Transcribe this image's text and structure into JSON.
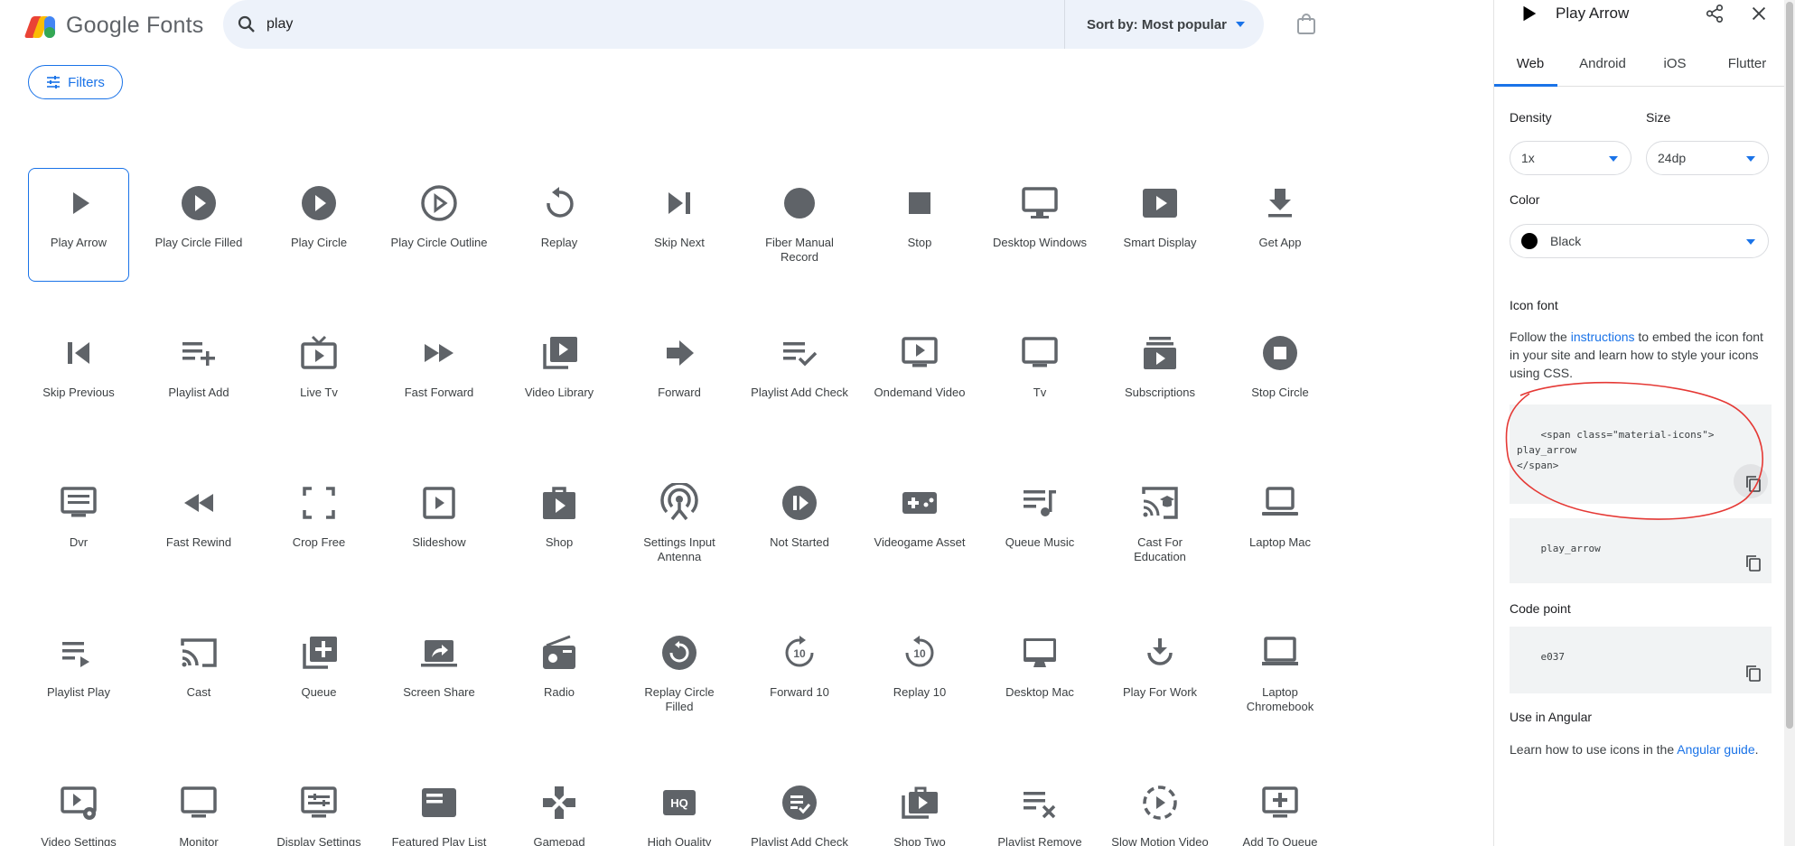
{
  "header": {
    "logo_text": "Google Fonts",
    "search_value": "play",
    "sort_label": "Sort by: Most popular",
    "filters_label": "Filters"
  },
  "colors": {
    "accent": "#1a73e8",
    "icon_gray": "#5f6368",
    "annotation": "#e53935"
  },
  "icons": [
    {
      "label": "Play Arrow",
      "icon": "play-arrow"
    },
    {
      "label": "Play Circle Filled",
      "icon": "play-circle-filled"
    },
    {
      "label": "Play Circle",
      "icon": "play-circle"
    },
    {
      "label": "Play Circle Outline",
      "icon": "play-circle-outline"
    },
    {
      "label": "Replay",
      "icon": "replay"
    },
    {
      "label": "Skip Next",
      "icon": "skip-next"
    },
    {
      "label": "Fiber Manual Record",
      "icon": "fiber-manual-record"
    },
    {
      "label": "Stop",
      "icon": "stop"
    },
    {
      "label": "Desktop Windows",
      "icon": "desktop-windows"
    },
    {
      "label": "Smart Display",
      "icon": "smart-display"
    },
    {
      "label": "Get App",
      "icon": "get-app"
    },
    {
      "label": "Skip Previous",
      "icon": "skip-previous"
    },
    {
      "label": "Playlist Add",
      "icon": "playlist-add"
    },
    {
      "label": "Live Tv",
      "icon": "live-tv"
    },
    {
      "label": "Fast Forward",
      "icon": "fast-forward"
    },
    {
      "label": "Video Library",
      "icon": "video-library"
    },
    {
      "label": "Forward",
      "icon": "forward"
    },
    {
      "label": "Playlist Add Check",
      "icon": "playlist-add-check"
    },
    {
      "label": "Ondemand Video",
      "icon": "ondemand-video"
    },
    {
      "label": "Tv",
      "icon": "tv"
    },
    {
      "label": "Subscriptions",
      "icon": "subscriptions"
    },
    {
      "label": "Stop Circle",
      "icon": "stop-circle"
    },
    {
      "label": "Dvr",
      "icon": "dvr"
    },
    {
      "label": "Fast Rewind",
      "icon": "fast-rewind"
    },
    {
      "label": "Crop Free",
      "icon": "crop-free"
    },
    {
      "label": "Slideshow",
      "icon": "slideshow"
    },
    {
      "label": "Shop",
      "icon": "shop"
    },
    {
      "label": "Settings Input Antenna",
      "icon": "settings-input-antenna"
    },
    {
      "label": "Not Started",
      "icon": "not-started"
    },
    {
      "label": "Videogame Asset",
      "icon": "videogame-asset"
    },
    {
      "label": "Queue Music",
      "icon": "queue-music"
    },
    {
      "label": "Cast For Education",
      "icon": "cast-for-education"
    },
    {
      "label": "Laptop Mac",
      "icon": "laptop-mac"
    },
    {
      "label": "Playlist Play",
      "icon": "playlist-play"
    },
    {
      "label": "Cast",
      "icon": "cast"
    },
    {
      "label": "Queue",
      "icon": "queue"
    },
    {
      "label": "Screen Share",
      "icon": "screen-share"
    },
    {
      "label": "Radio",
      "icon": "radio"
    },
    {
      "label": "Replay Circle Filled",
      "icon": "replay-circle-filled"
    },
    {
      "label": "Forward 10",
      "icon": "forward-10"
    },
    {
      "label": "Replay 10",
      "icon": "replay-10"
    },
    {
      "label": "Desktop Mac",
      "icon": "desktop-mac"
    },
    {
      "label": "Play For Work",
      "icon": "play-for-work"
    },
    {
      "label": "Laptop Chromebook",
      "icon": "laptop-chromebook"
    },
    {
      "label": "Video Settings",
      "icon": "video-settings"
    },
    {
      "label": "Monitor",
      "icon": "monitor"
    },
    {
      "label": "Display Settings",
      "icon": "display-settings"
    },
    {
      "label": "Featured Play List",
      "icon": "featured-play-list"
    },
    {
      "label": "Gamepad",
      "icon": "gamepad"
    },
    {
      "label": "High Quality",
      "icon": "high-quality"
    },
    {
      "label": "Playlist Add Check Circle",
      "icon": "playlist-add-check-circle"
    },
    {
      "label": "Shop Two",
      "icon": "shop-two"
    },
    {
      "label": "Playlist Remove",
      "icon": "playlist-remove"
    },
    {
      "label": "Slow Motion Video",
      "icon": "slow-motion-video"
    },
    {
      "label": "Add To Queue",
      "icon": "add-to-queue"
    }
  ],
  "panel": {
    "title": "Play Arrow",
    "tabs": [
      "Web",
      "Android",
      "iOS",
      "Flutter"
    ],
    "density_label": "Density",
    "density_value": "1x",
    "size_label": "Size",
    "size_value": "24dp",
    "color_label": "Color",
    "color_value": "Black",
    "icon_font_label": "Icon font",
    "icon_font_text_before": "Follow the ",
    "icon_font_link": "instructions",
    "icon_font_text_after": " to embed the icon font in your site and learn how to style your icons using CSS.",
    "code_snippet": "<span class=\"material-icons\">\nplay_arrow\n</span>",
    "ligature": "play_arrow",
    "code_point_label": "Code point",
    "code_point": "e037",
    "angular_label": "Use in Angular",
    "angular_text_before": "Learn how to use icons in the ",
    "angular_link": "Angular guide",
    "angular_text_after": "."
  }
}
